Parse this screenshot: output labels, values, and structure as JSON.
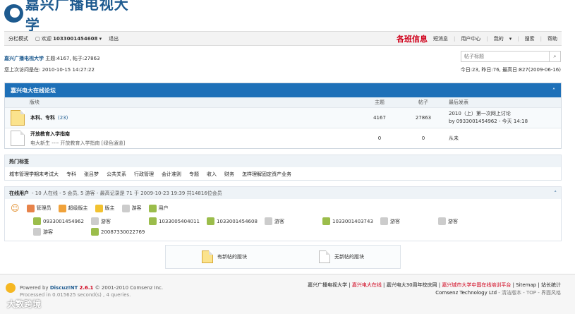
{
  "logo": {
    "text": "嘉兴广播电视大学"
  },
  "topbar": {
    "mode": "分栏模式",
    "welcome": "欢迎",
    "user": "1033001454608",
    "logout": "退出",
    "notice": "各班信息",
    "links": [
      "短消息",
      "用户中心",
      "我的",
      "搜索",
      "帮助"
    ]
  },
  "info": {
    "site": "嘉兴广播电视大学",
    "counts": "主题:4167, 帖子:27863",
    "last_visit": "您上次访问是在: 2010-10-15 14:27:22",
    "search_placeholder": "帖子标题",
    "stats": "今日:23, 昨日:76, 最高日:827(2009-06-16)"
  },
  "category": {
    "title": "嘉兴电大在线论坛",
    "cols": [
      "版块",
      "主题",
      "帖子",
      "最后发表"
    ],
    "forums": [
      {
        "name": "本科、专科",
        "count": "(23)",
        "topics": "4167",
        "posts": "27863",
        "last_title": "2010（上）第一次网上讨论",
        "last_by": "by 0933001454962 - 今天 14:18"
      },
      {
        "name": "开放教育入学指南",
        "desc": "电大新生 ---- 开放教育入学指南 [绿色通道]",
        "topics": "0",
        "posts": "0",
        "last_title": "从未"
      }
    ]
  },
  "tags": {
    "title": "热门标签",
    "items": [
      "城市管理学期末考试大",
      "专科",
      "张吕梦",
      "公共关系",
      "行政管理",
      "会计准则",
      "专题",
      "收入",
      "财务",
      "怎样理解固定资产业务"
    ]
  },
  "online": {
    "title": "在线用户",
    "summary": "- 10 人在线 - 5 会员, 5 游客 - 最高记录是 71 于 2009-10-23 19:39 共14816位会员",
    "legend": [
      "管理员",
      "超级版主",
      "版主",
      "游客",
      "用户"
    ],
    "users": [
      "0933001454962",
      "游客",
      "1033005404011",
      "1033001454608",
      "游客",
      "1033001403743",
      "游客",
      "游客",
      "游客",
      "20087330022769"
    ]
  },
  "legend": {
    "new": "有新帖的版块",
    "none": "无新帖的版块"
  },
  "footer": {
    "powered": "Powered by",
    "product": "Discuz!NT",
    "version": "2.6.1",
    "copy": "© 2001-2010 Comsenz Inc.",
    "processed": "Processed in 0.015625 second(s) , 4 queries.",
    "links": [
      "嘉兴广播电视大学",
      "嘉兴电大在线",
      "嘉兴电大30周年校庆网",
      "嘉兴城市大学中国在线培训平台",
      "Sitemap",
      "站长统计"
    ],
    "company": "Comsenz Technology Ltd",
    "style": "- 清洁版本 - TOP - 界面风格"
  },
  "watermark": "大数跨境",
  "colors": {
    "accent": "#1e70b8",
    "red": "#d0011b"
  }
}
